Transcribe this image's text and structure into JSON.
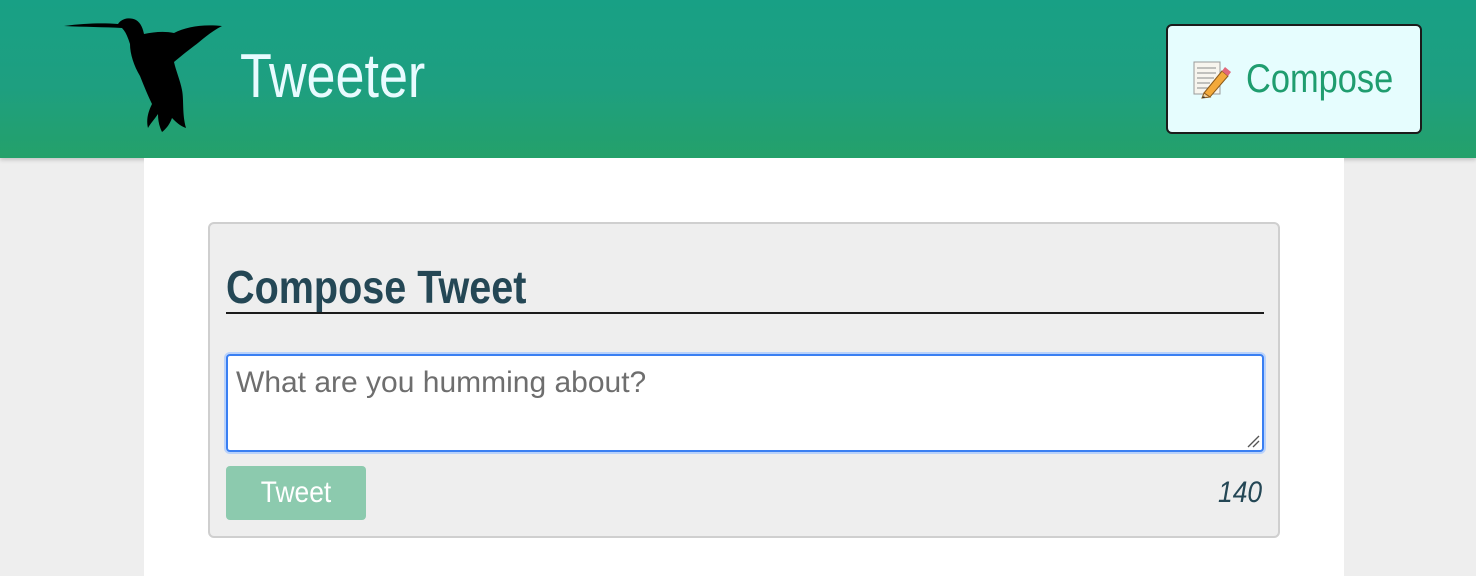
{
  "header": {
    "brand_title": "Tweeter",
    "logo_icon": "hummingbird-icon",
    "compose_button": {
      "label": "Compose",
      "icon": "memo-icon"
    }
  },
  "compose_form": {
    "title": "Compose Tweet",
    "input_value": "",
    "input_placeholder": "What are you humming about?",
    "submit_label": "Tweet",
    "char_counter": "140"
  },
  "colors": {
    "header_gradient_top": "#18a085",
    "header_gradient_bottom": "#24a16a",
    "brand_text": "#e8fbff",
    "compose_button_bg": "#e6fdfe",
    "compose_button_text": "#1f9d6f",
    "panel_title": "#244755",
    "tweet_button_bg": "#8ccaae",
    "input_focus_border": "#3a7ff2"
  }
}
